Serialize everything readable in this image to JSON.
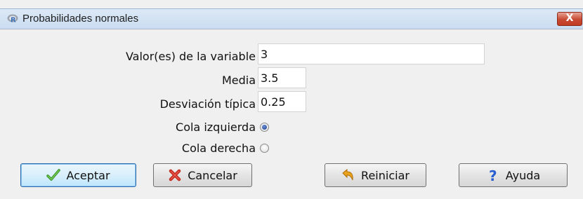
{
  "window": {
    "title": "Probabilidades normales",
    "close_label": "X"
  },
  "form": {
    "variable_label": "Valor(es) de la variable",
    "variable_value": "3",
    "mean_label": "Media",
    "mean_value": "3.5",
    "sd_label": "Desviación típica",
    "sd_value": "0.25",
    "left_tail_label": "Cola izquierda",
    "right_tail_label": "Cola derecha",
    "selected_tail": "left"
  },
  "buttons": {
    "ok": "Aceptar",
    "cancel": "Cancelar",
    "reset": "Reiniciar",
    "help": "Ayuda"
  },
  "icons": {
    "app": "r-logo-icon",
    "ok": "checkmark-icon",
    "cancel": "x-cross-icon",
    "reset": "undo-arrow-icon",
    "help": "question-mark-icon"
  }
}
